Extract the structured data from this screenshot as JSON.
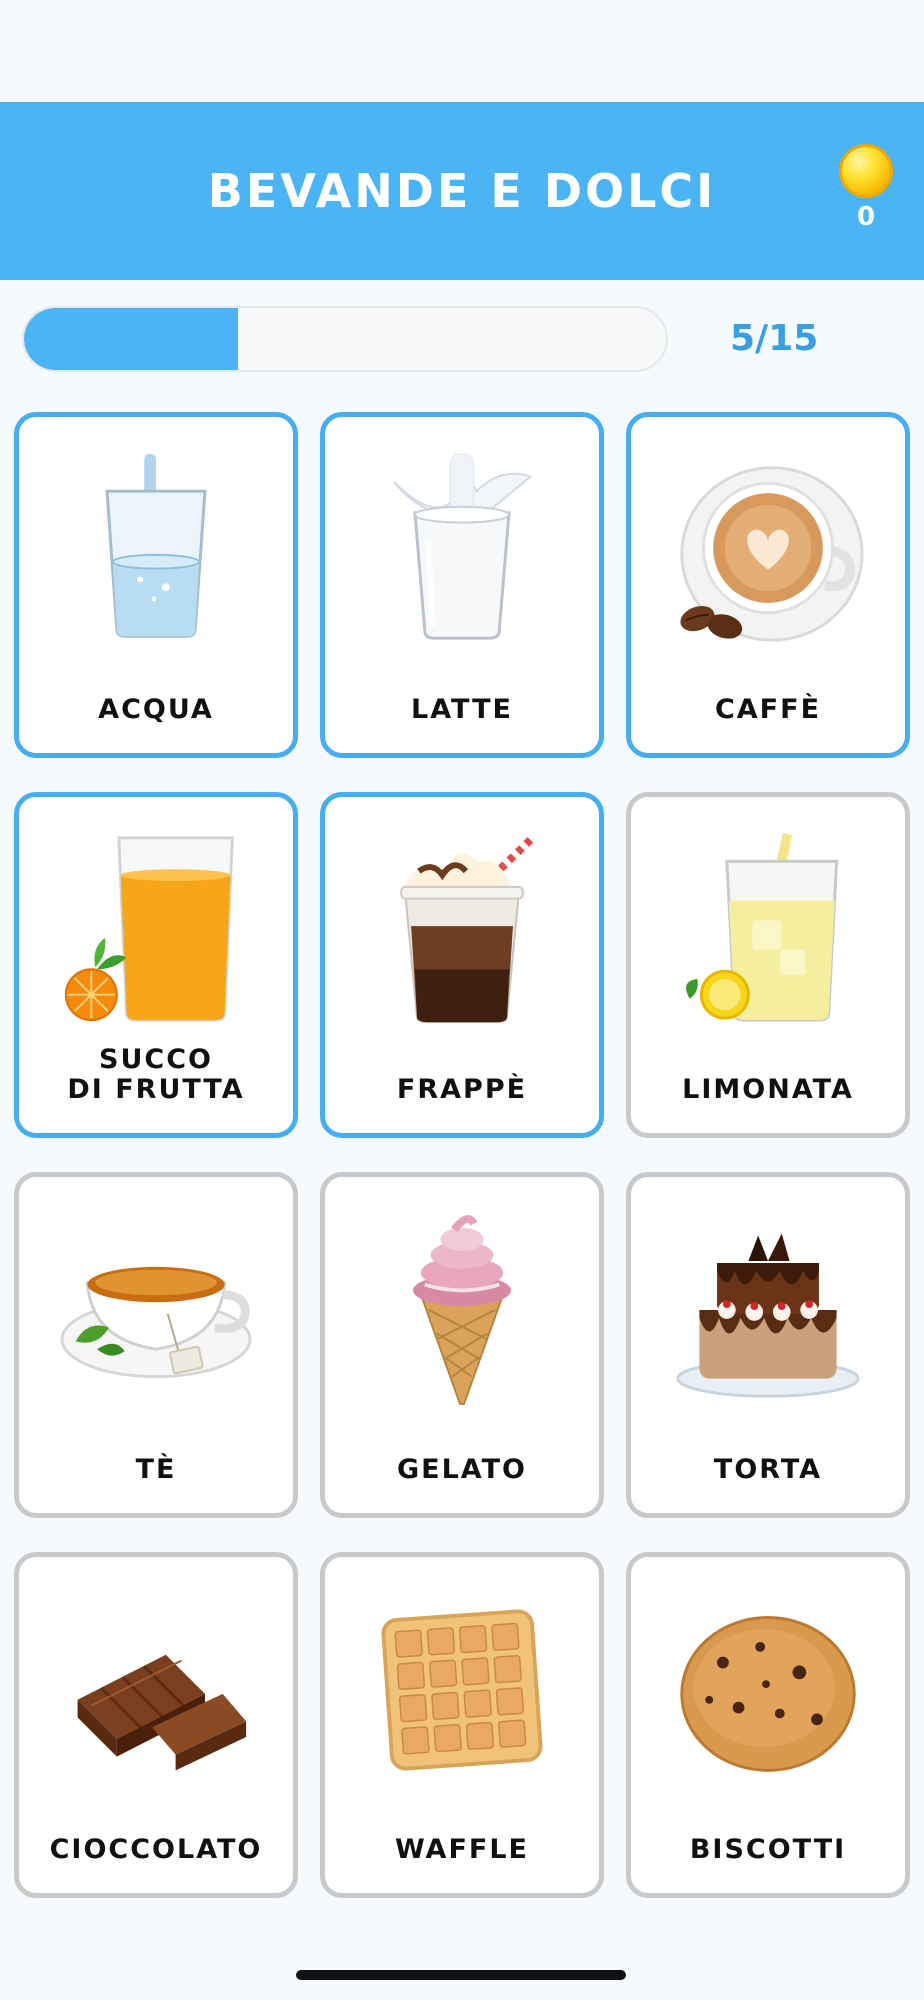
{
  "header": {
    "title": "BEVANDE E DOLCI",
    "coins": "0",
    "coin_icon": "gold-coin-icon"
  },
  "progress": {
    "current": 5,
    "total": 15,
    "label": "5/15",
    "fraction": 0.333
  },
  "colors": {
    "accent": "#4ab4f5",
    "selected_border": "#46adf0",
    "card_border": "#c9c9c9"
  },
  "cards": [
    {
      "label": "ACQUA",
      "selected": true,
      "icon": "glass-of-water"
    },
    {
      "label": "LATTE",
      "selected": true,
      "icon": "glass-of-milk"
    },
    {
      "label": "CAFFÈ",
      "selected": true,
      "icon": "cappuccino-cup"
    },
    {
      "label": "SUCCO\nDI FRUTTA",
      "selected": true,
      "icon": "orange-juice"
    },
    {
      "label": "FRAPPÈ",
      "selected": true,
      "icon": "iced-coffee"
    },
    {
      "label": "LIMONATA",
      "selected": false,
      "icon": "lemonade"
    },
    {
      "label": "TÈ",
      "selected": false,
      "icon": "tea-cup"
    },
    {
      "label": "GELATO",
      "selected": false,
      "icon": "ice-cream-cone"
    },
    {
      "label": "TORTA",
      "selected": false,
      "icon": "chocolate-cake"
    },
    {
      "label": "CIOCCOLATO",
      "selected": false,
      "icon": "chocolate-bar"
    },
    {
      "label": "WAFFLE",
      "selected": false,
      "icon": "waffle"
    },
    {
      "label": "BISCOTTI",
      "selected": false,
      "icon": "cookie"
    }
  ]
}
